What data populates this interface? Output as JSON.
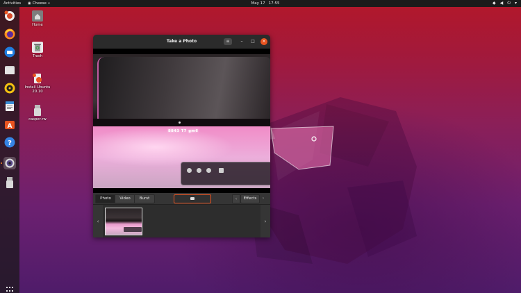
{
  "topbar": {
    "activities": "Activities",
    "app_name": "Cheese",
    "date": "May 17",
    "time": "17:55"
  },
  "desktop_icons": [
    {
      "label": "Home",
      "icon": "home-folder-icon"
    },
    {
      "label": "Trash",
      "icon": "trash-icon"
    },
    {
      "label": "Install Ubuntu 20.10",
      "icon": "installer-icon"
    },
    {
      "label": "casper-rw",
      "icon": "usb-drive-icon"
    }
  ],
  "dock": {
    "items": [
      "help-installer-icon",
      "firefox-icon",
      "thunderbird-icon",
      "files-icon",
      "rhythmbox-icon",
      "writer-icon",
      "software-icon",
      "help-icon",
      "cheese-icon",
      "usb-drive-icon"
    ]
  },
  "window": {
    "title": "Take a Photo",
    "menu_icon": "≡",
    "minimize_icon": "–",
    "maximize_icon": "□",
    "close_icon": "×"
  },
  "feed": {
    "caption": "8843 T7 gm6"
  },
  "controls": {
    "tabs": {
      "photo": "Photo",
      "video": "Video",
      "burst": "Burst"
    },
    "selected_tab": "Photo",
    "effects": "Effects",
    "prev_arrow": "‹",
    "next_arrow": "›"
  },
  "thumbnails": {
    "prev_arrow": "‹",
    "next_arrow": "›",
    "count": 1
  },
  "colors": {
    "accent": "#e95420",
    "topbar": "#1b1b1b",
    "window": "#353535"
  }
}
